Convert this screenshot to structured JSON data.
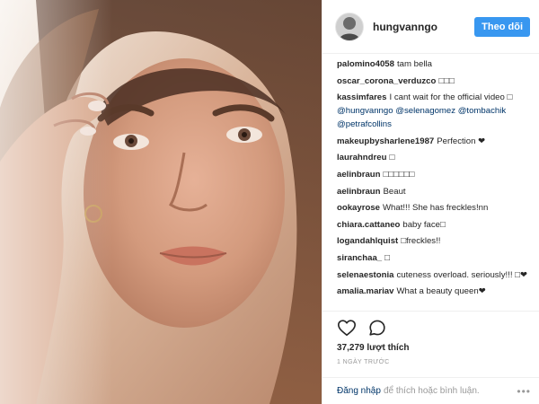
{
  "header": {
    "username": "hungvanngo",
    "follow_label": "Theo dõi"
  },
  "comments": [
    {
      "user": "palomino4058",
      "text": "tam bella"
    },
    {
      "user": "oscar_corona_verduzco",
      "text": "□□□"
    },
    {
      "user": "kassimfares",
      "text": "I cant wait for the official video □",
      "mentions": "@hungvanngo @selenagomez @tombachik @petrafcollins"
    },
    {
      "user": "makeupbysharlene1987",
      "text": "Perfection ❤"
    },
    {
      "user": "laurahndreu",
      "text": "□"
    },
    {
      "user": "aelinbraun",
      "text": "□□□□□□"
    },
    {
      "user": "aelinbraun",
      "text": "Beaut"
    },
    {
      "user": "ookayrose",
      "text": "What!!! She has freckles!nn"
    },
    {
      "user": "chiara.cattaneo",
      "text": "baby face□"
    },
    {
      "user": "logandahlquist",
      "text": "□freckles!!"
    },
    {
      "user": "siranchaa_",
      "text": "□"
    },
    {
      "user": "selenaestonia",
      "text": "cuteness overload. seriously!!! □❤"
    },
    {
      "user": "amalia.mariav",
      "text": "What a beauty queen❤"
    }
  ],
  "actions": {
    "like_icon": "heart-icon",
    "comment_icon": "speech-bubble-icon",
    "likes_text": "37,279 lượt thích",
    "time_text": "1 NGÀY TRƯỚC"
  },
  "login": {
    "link_label": "Đăng nhập",
    "text": "để thích hoặc bình luận.",
    "more_label": "•••"
  },
  "colors": {
    "accent": "#3897f0",
    "link": "#003569",
    "muted": "#999999"
  }
}
